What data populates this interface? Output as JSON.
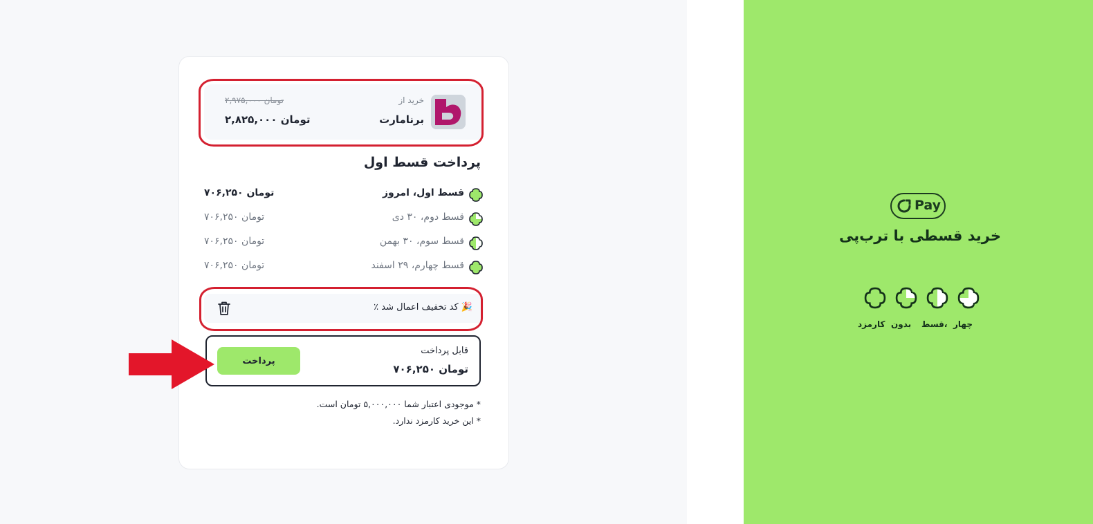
{
  "merchant": {
    "from_label": "خرید از",
    "name": "برنامارت",
    "old_price": "۲,۹۷۵,۰۰۰ تومان",
    "new_price": "۲,۸۲۵,۰۰۰ تومان"
  },
  "installments": {
    "title": "پرداخت قسط اول",
    "items": [
      {
        "label": "قسط اول، امروز",
        "amount": "۷۰۶,۲۵۰ تومان"
      },
      {
        "label": "قسط دوم، ۳۰ دی",
        "amount": "۷۰۶,۲۵۰ تومان"
      },
      {
        "label": "قسط سوم، ۳۰ بهمن",
        "amount": "۷۰۶,۲۵۰ تومان"
      },
      {
        "label": "قسط چهارم، ۲۹ اسفند",
        "amount": "۷۰۶,۲۵۰ تومان"
      }
    ]
  },
  "discount": {
    "text": "٪ کد تخفیف اعمال شد 🎉",
    "delete_icon": "trash-icon"
  },
  "payment": {
    "payable_label": "قابل پرداخت",
    "payable_amount": "۷۰۶,۲۵۰ تومان",
    "pay_button": "پرداخت"
  },
  "notes": [
    "* موجودی اعتبار شما ۵,۰۰۰,۰۰۰ تومان است.",
    "* این خرید کارمزد ندارد."
  ],
  "side": {
    "logo_text": "Pay",
    "title": "خرید قسطی با ترب‌پی",
    "features": [
      "چهار",
      "قسط،",
      "بدون",
      "کارمزد"
    ]
  },
  "colors": {
    "brand_green": "#9ee86b",
    "dark_text": "#1f2430",
    "annotation_red": "#d42030",
    "merchant_logo": "#b0176b"
  }
}
